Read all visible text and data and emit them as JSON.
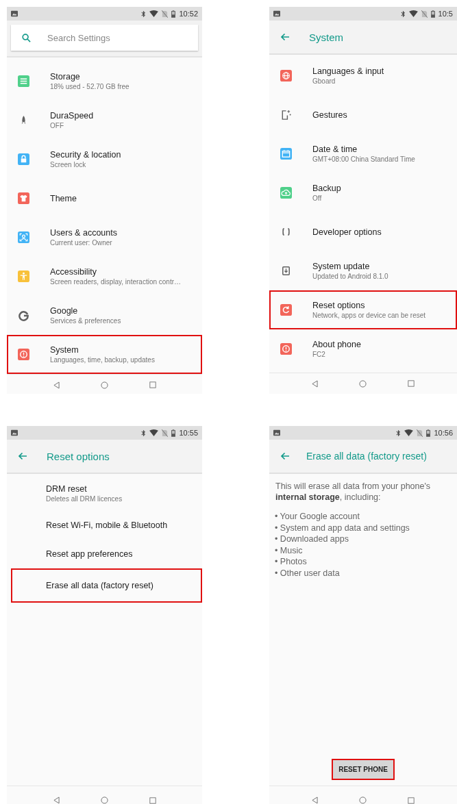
{
  "screens": [
    {
      "kind": "home",
      "time": "10:52",
      "search": {
        "placeholder": "Search Settings"
      },
      "items": [
        {
          "kind": "storage",
          "color": "#4fd08a",
          "title": "Storage",
          "subtitle": "18% used - 52.70 GB free",
          "highlighted": false
        },
        {
          "kind": "rocket",
          "color": "#616161",
          "title": "DuraSpeed",
          "subtitle": "OFF",
          "highlighted": false
        },
        {
          "kind": "lock",
          "color": "#42b3f5",
          "title": "Security & location",
          "subtitle": "Screen lock",
          "highlighted": false
        },
        {
          "kind": "shirt",
          "color": "#f2655a",
          "title": "Theme",
          "highlighted": false
        },
        {
          "kind": "person",
          "color": "#42b3f5",
          "title": "Users & accounts",
          "subtitle": "Current user: Owner",
          "highlighted": false
        },
        {
          "kind": "accessibility",
          "color": "#f8c13a",
          "title": "Accessibility",
          "subtitle": "Screen readers, display, interaction contr…",
          "highlighted": false
        },
        {
          "kind": "google",
          "color": "#616161",
          "title": "Google",
          "subtitle": "Services & preferences",
          "highlighted": false
        },
        {
          "kind": "alert",
          "color": "#f2655a",
          "title": "System",
          "subtitle": "Languages, time, backup, updates",
          "highlighted": true
        }
      ]
    },
    {
      "kind": "list",
      "time": "10:5",
      "title": "System",
      "items": [
        {
          "kind": "globe",
          "color": "#f2655a",
          "title": "Languages & input",
          "subtitle": "Gboard",
          "highlighted": false
        },
        {
          "kind": "gesture",
          "color": "#616161",
          "title": "Gestures",
          "highlighted": false
        },
        {
          "kind": "calendar",
          "color": "#42b3f5",
          "title": "Date & time",
          "subtitle": "GMT+08:00 China Standard Time",
          "highlighted": false
        },
        {
          "kind": "cloud",
          "color": "#4fd08a",
          "title": "Backup",
          "subtitle": "Off",
          "highlighted": false
        },
        {
          "kind": "braces",
          "color": "#616161",
          "title": "Developer options",
          "highlighted": false
        },
        {
          "kind": "download",
          "color": "#616161",
          "title": "System update",
          "subtitle": "Updated to Android 8.1.0",
          "highlighted": false
        },
        {
          "kind": "reset",
          "color": "#f2655a",
          "title": "Reset options",
          "subtitle": "Network, apps or device can be reset",
          "highlighted": true
        },
        {
          "kind": "alert",
          "color": "#f2655a",
          "title": "About phone",
          "subtitle": "FC2",
          "highlighted": false
        }
      ]
    },
    {
      "kind": "list",
      "time": "10:55",
      "title": "Reset options",
      "items": [
        {
          "title": "DRM reset",
          "subtitle": "Deletes all DRM licences",
          "highlighted": false
        },
        {
          "title": "Reset Wi-Fi, mobile & Bluetooth",
          "highlighted": false
        },
        {
          "title": "Reset app preferences",
          "highlighted": false
        },
        {
          "title": "Erase all data (factory reset)",
          "highlighted": true
        }
      ]
    },
    {
      "kind": "message",
      "time": "10:56",
      "title": "Erase all data (factory reset)",
      "intro": "This will erase all data from your phone's **internal storage**, including:",
      "bullets": [
        "• Your Google account",
        "• System and app data and settings",
        "• Downloaded apps",
        "• Music",
        "• Photos",
        "• Other user data"
      ],
      "button": {
        "label": "RESET PHONE",
        "highlighted": true
      }
    }
  ]
}
